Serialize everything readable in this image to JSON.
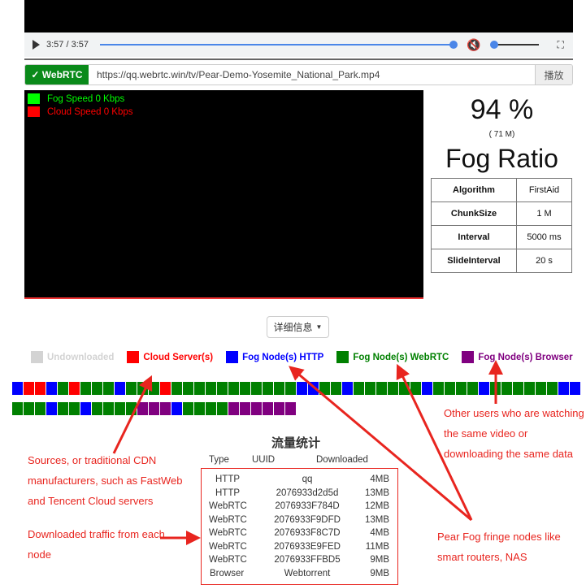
{
  "player": {
    "time": "3:57 / 3:57",
    "progress": 1.0,
    "volume": 0.0,
    "muted": true
  },
  "source": {
    "badge": "✓ WebRTC",
    "url": "https://qq.webrtc.win/tv/Pear-Demo-Yosemite_National_Park.mp4",
    "play_label": "播放"
  },
  "speed_legend": {
    "fog": "Fog Speed 0 Kbps",
    "cloud": "Cloud Speed 0 Kbps",
    "fog_color": "#00ff00",
    "cloud_color": "#ff0000"
  },
  "stats": {
    "percent": "94 %",
    "amount": "( 71 M)",
    "label": "Fog Ratio",
    "params": [
      {
        "k": "Algorithm",
        "v": "FirstAid"
      },
      {
        "k": "ChunkSize",
        "v": "1 M"
      },
      {
        "k": "Interval",
        "v": "5000 ms"
      },
      {
        "k": "SlideInterval",
        "v": "20 s"
      }
    ]
  },
  "details_button": "详细信息",
  "legend": [
    {
      "label": "Undownloaded",
      "color": "#d3d3d3"
    },
    {
      "label": "Cloud Server(s)",
      "color": "#ff0000"
    },
    {
      "label": "Fog Node(s) HTTP",
      "color": "#0000ff"
    },
    {
      "label": "Fog Node(s) WebRTC",
      "color": "#008000"
    },
    {
      "label": "Fog Node(s) Browser",
      "color": "#800080"
    }
  ],
  "chunks": {
    "colors": {
      "C": "#ff0000",
      "H": "#0000ff",
      "W": "#008000",
      "B": "#800080",
      "U": "#d3d3d3"
    },
    "rows": [
      "HCCHWCWWWHWWWCWWWWWWWWWWWHHWWHWWWWWWHWWWWHWWWWWWHH",
      "WWWHWWHWWWWBBBHWWWWBBBBBB"
    ]
  },
  "traffic": {
    "title": "流量统计",
    "headers": [
      "Type",
      "UUID",
      "Downloaded"
    ],
    "rows": [
      [
        "HTTP",
        "qq",
        "4MB"
      ],
      [
        "HTTP",
        "2076933d2d5d",
        "13MB"
      ],
      [
        "WebRTC",
        "2076933F784D",
        "12MB"
      ],
      [
        "WebRTC",
        "2076933F9DFD",
        "13MB"
      ],
      [
        "WebRTC",
        "2076933F8C7D",
        "4MB"
      ],
      [
        "WebRTC",
        "2076933E9FED",
        "11MB"
      ],
      [
        "WebRTC",
        "2076933FFBD5",
        "9MB"
      ],
      [
        "Browser",
        "Webtorrent",
        "9MB"
      ]
    ]
  },
  "annotations": {
    "sources": "Sources, or traditional CDN manufacturers, such as FastWeb and Tencent Cloud servers",
    "traffic": "Downloaded traffic from each node",
    "fringe": "Pear Fog fringe nodes like smart routers, NAS",
    "others": "Other users who are watching the same video or downloading the same data",
    "color": "#e8251f"
  }
}
